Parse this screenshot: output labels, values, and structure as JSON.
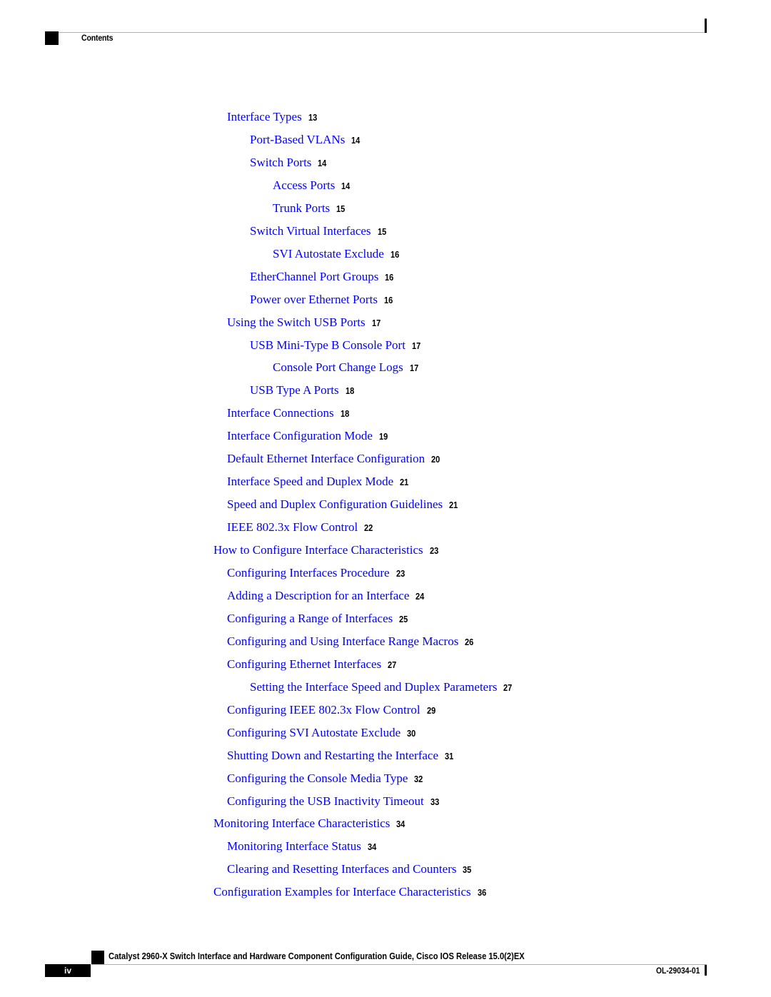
{
  "header": {
    "section_label": "Contents"
  },
  "colors": {
    "link": "#0000ff",
    "text": "#000000",
    "rule": "#b0b0b0"
  },
  "toc": [
    {
      "level": 1,
      "title": "Interface Types",
      "page": "13"
    },
    {
      "level": 2,
      "title": "Port-Based VLANs",
      "page": "14"
    },
    {
      "level": 2,
      "title": "Switch Ports",
      "page": "14"
    },
    {
      "level": 3,
      "title": "Access Ports",
      "page": "14"
    },
    {
      "level": 3,
      "title": "Trunk Ports",
      "page": "15"
    },
    {
      "level": 2,
      "title": "Switch Virtual Interfaces",
      "page": "15"
    },
    {
      "level": 3,
      "title": "SVI Autostate Exclude",
      "page": "16"
    },
    {
      "level": 2,
      "title": "EtherChannel Port Groups",
      "page": "16"
    },
    {
      "level": 2,
      "title": "Power over Ethernet Ports",
      "page": "16"
    },
    {
      "level": 1,
      "title": "Using the Switch USB Ports",
      "page": "17"
    },
    {
      "level": 2,
      "title": "USB Mini-Type B Console Port",
      "page": "17"
    },
    {
      "level": 3,
      "title": "Console Port Change Logs",
      "page": "17"
    },
    {
      "level": 2,
      "title": "USB Type A Ports",
      "page": "18"
    },
    {
      "level": 1,
      "title": "Interface Connections",
      "page": "18"
    },
    {
      "level": 1,
      "title": "Interface Configuration Mode",
      "page": "19"
    },
    {
      "level": 1,
      "title": "Default Ethernet Interface Configuration",
      "page": "20"
    },
    {
      "level": 1,
      "title": "Interface Speed and Duplex Mode",
      "page": "21"
    },
    {
      "level": 1,
      "title": "Speed and Duplex Configuration Guidelines",
      "page": "21"
    },
    {
      "level": 1,
      "title": "IEEE 802.3x Flow Control",
      "page": "22"
    },
    {
      "level": 0,
      "title": "How to Configure Interface Characteristics",
      "page": "23"
    },
    {
      "level": 1,
      "title": "Configuring Interfaces Procedure",
      "page": "23"
    },
    {
      "level": 1,
      "title": "Adding a Description for an Interface",
      "page": "24"
    },
    {
      "level": 1,
      "title": "Configuring a Range of Interfaces",
      "page": "25"
    },
    {
      "level": 1,
      "title": "Configuring and Using Interface Range Macros",
      "page": "26"
    },
    {
      "level": 1,
      "title": "Configuring Ethernet Interfaces",
      "page": "27"
    },
    {
      "level": 2,
      "title": "Setting the Interface Speed and Duplex Parameters",
      "page": "27"
    },
    {
      "level": 1,
      "title": "Configuring IEEE 802.3x Flow Control",
      "page": "29"
    },
    {
      "level": 1,
      "title": "Configuring SVI Autostate Exclude",
      "page": "30"
    },
    {
      "level": 1,
      "title": "Shutting Down and Restarting the Interface",
      "page": "31"
    },
    {
      "level": 1,
      "title": "Configuring the Console Media Type",
      "page": "32"
    },
    {
      "level": 1,
      "title": "Configuring the USB Inactivity Timeout",
      "page": "33"
    },
    {
      "level": 0,
      "title": "Monitoring Interface Characteristics",
      "page": "34"
    },
    {
      "level": 1,
      "title": "Monitoring Interface Status",
      "page": "34"
    },
    {
      "level": 1,
      "title": "Clearing and Resetting Interfaces and Counters",
      "page": "35"
    },
    {
      "level": 0,
      "title": "Configuration Examples for Interface Characteristics",
      "page": "36"
    }
  ],
  "footer": {
    "book_title": "Catalyst 2960-X Switch Interface and Hardware Component Configuration Guide, Cisco IOS Release 15.0(2)EX",
    "page_number": "iv",
    "doc_number": "OL-29034-01"
  }
}
